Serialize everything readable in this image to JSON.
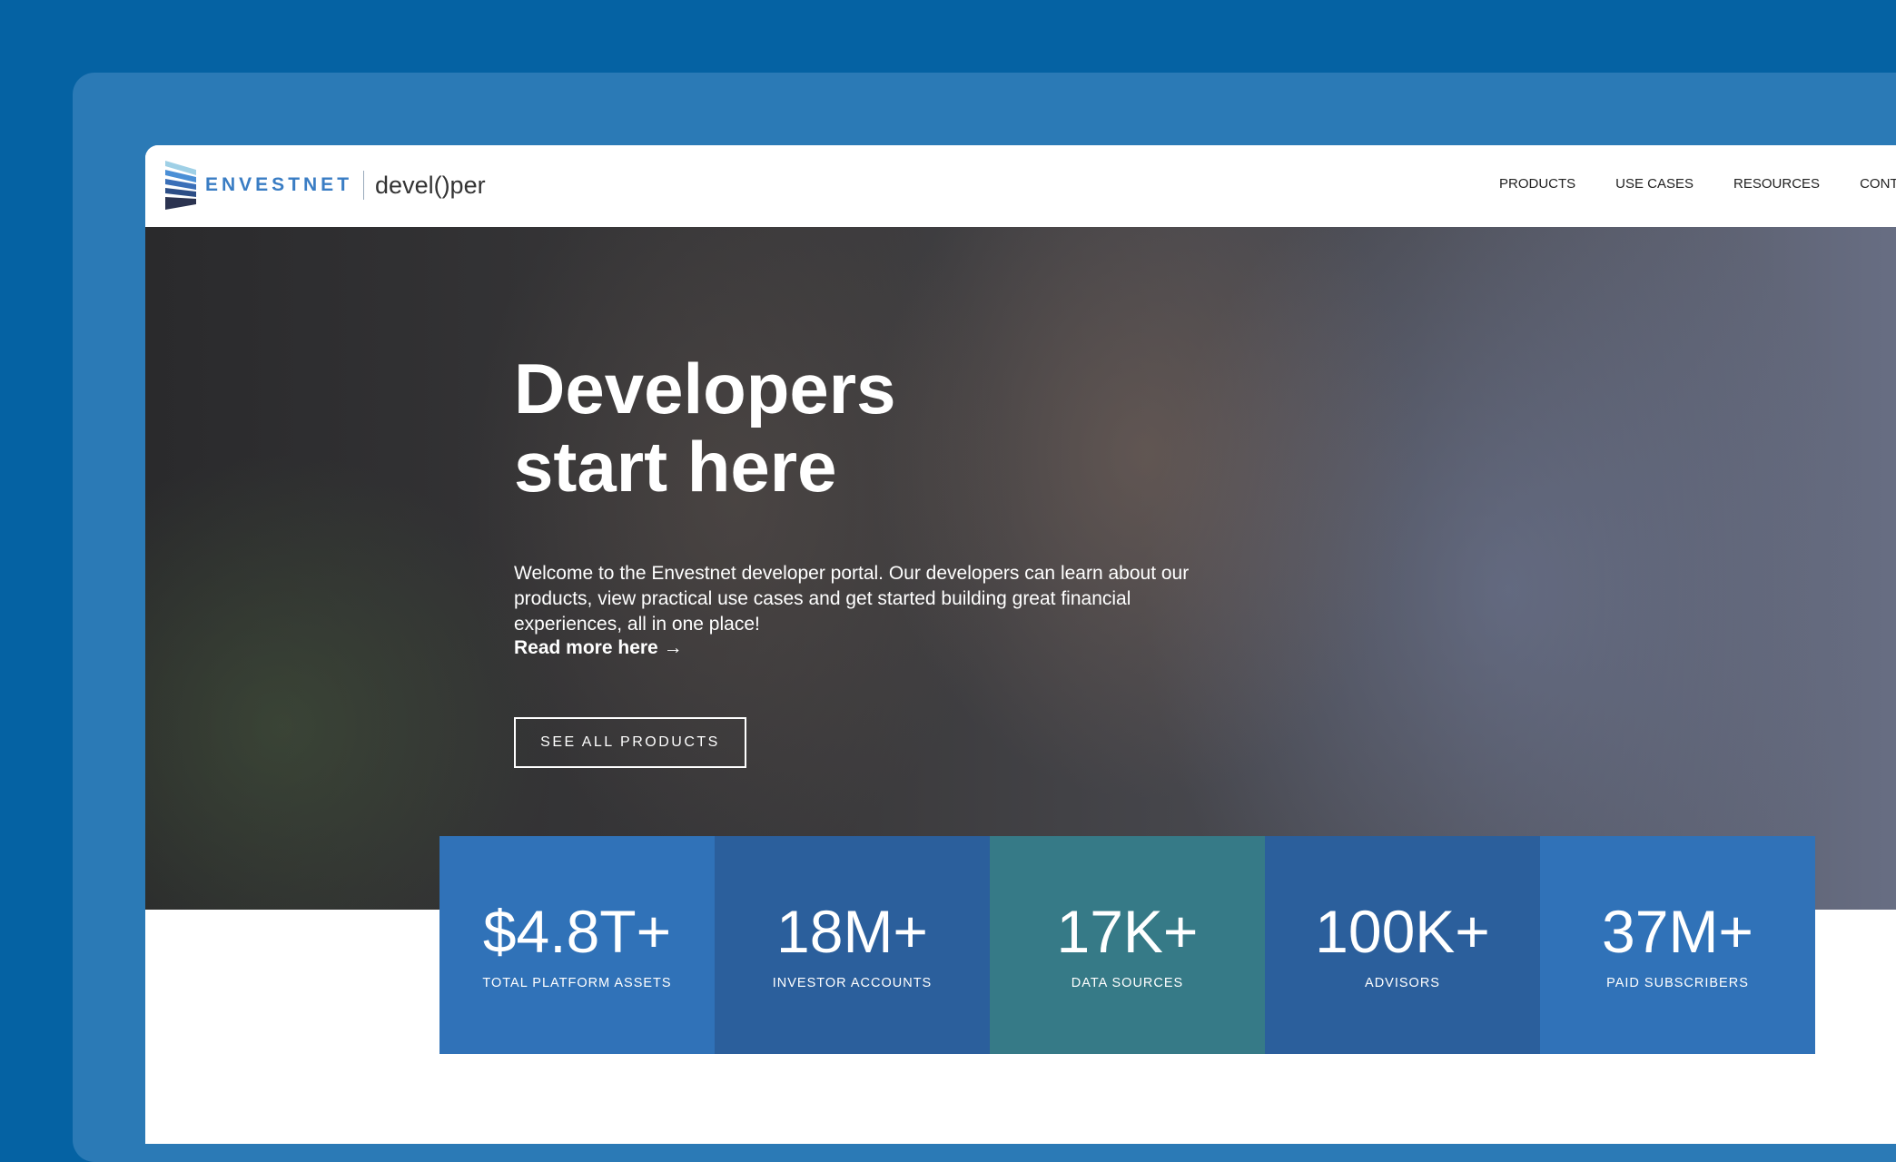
{
  "nav": {
    "brand": "ENVESTNET",
    "product": "devel()per",
    "items": [
      "PRODUCTS",
      "USE CASES",
      "RESOURCES",
      "CONT"
    ]
  },
  "hero": {
    "title_line1": "Developers",
    "title_line2": "start here",
    "description": "Welcome to the Envestnet developer portal. Our developers can learn about our products, view practical use cases and get started building great financial experiences, all in one place!",
    "read_more": "Read more here →",
    "cta": "SEE ALL PRODUCTS"
  },
  "stats": [
    {
      "value": "$4.8T+",
      "label": "TOTAL PLATFORM ASSETS",
      "color": "#3072b8"
    },
    {
      "value": "18M+",
      "label": "INVESTOR ACCOUNTS",
      "color": "#2b5f9c"
    },
    {
      "value": "17K+",
      "label": "DATA SOURCES",
      "color": "#367a87"
    },
    {
      "value": "100K+",
      "label": "ADVISORS",
      "color": "#2b5f9c"
    },
    {
      "value": "37M+",
      "label": "PAID SUBSCRIBERS",
      "color": "#3072b8"
    }
  ]
}
